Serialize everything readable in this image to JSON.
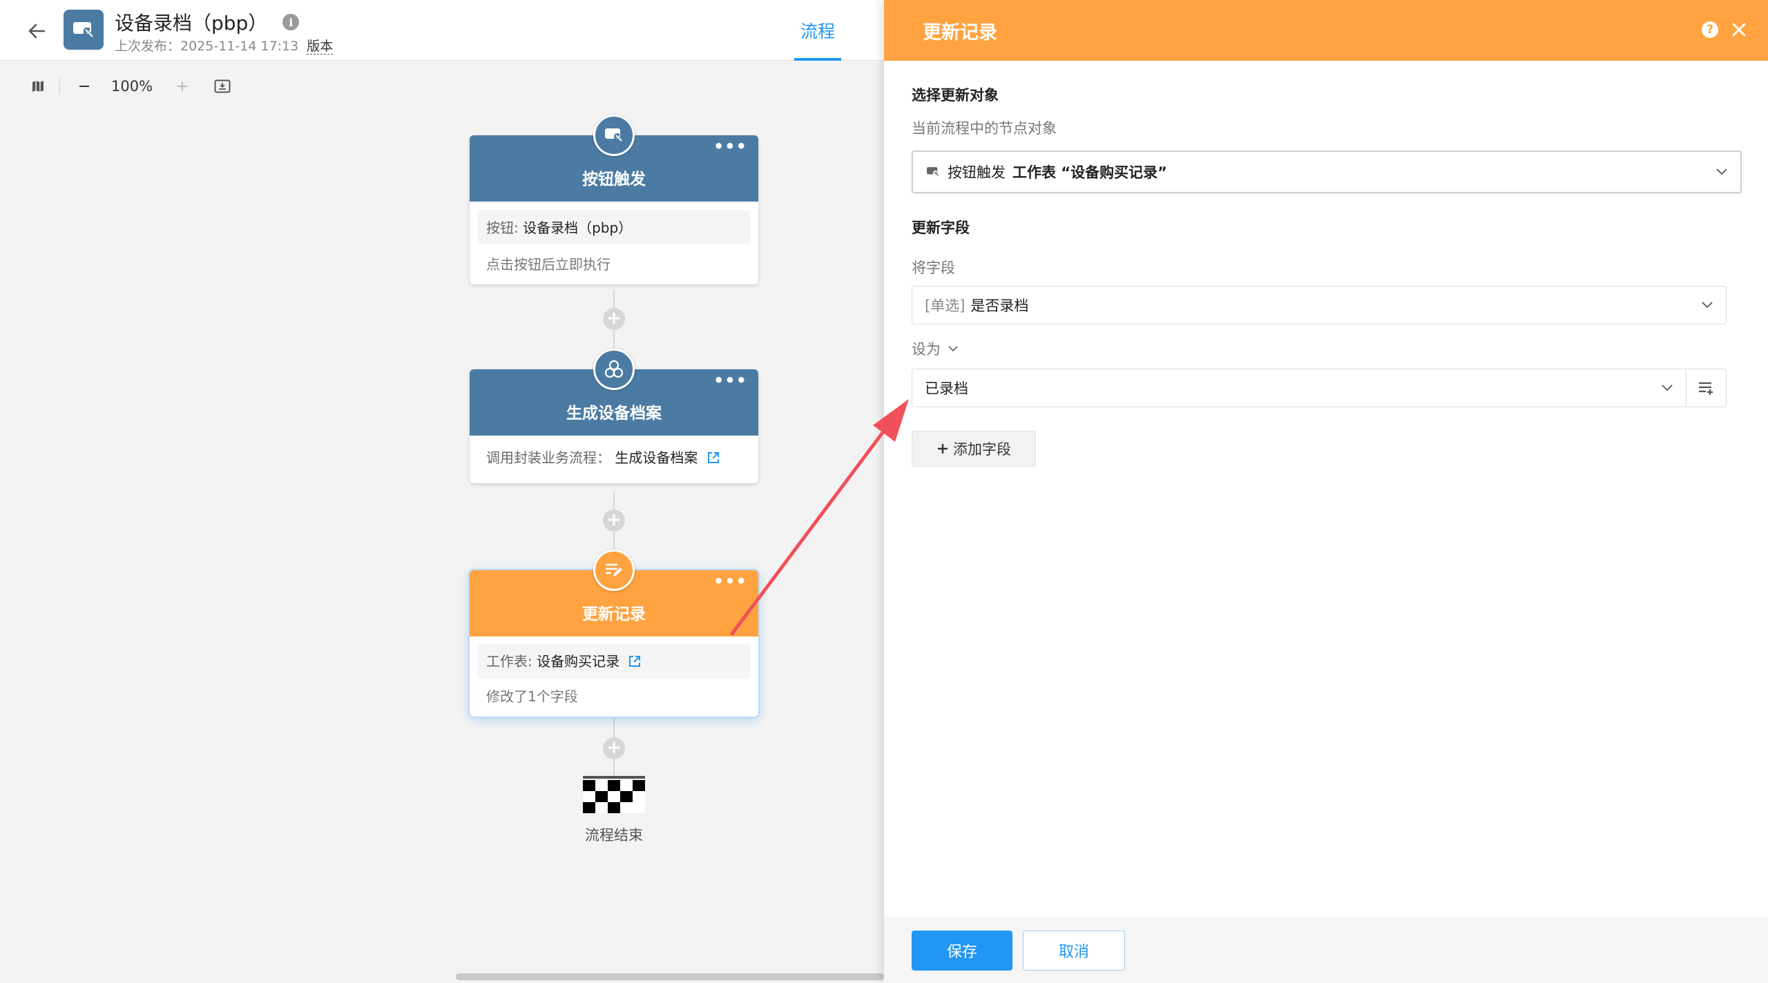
{
  "header": {
    "title": "设备录档（pbp）",
    "last_publish": "上次发布：2025-11-14 17:13",
    "version_label": "版本",
    "tab_flow": "流程"
  },
  "toolbar": {
    "zoom": "100%"
  },
  "flow": {
    "trigger": {
      "title": "按钮触发",
      "button_label": "按钮:",
      "button_value": "设备录档（pbp）",
      "desc": "点击按钮后立即执行"
    },
    "subprocess": {
      "title": "生成设备档案",
      "call_label": "调用封装业务流程：",
      "call_value": "生成设备档案"
    },
    "update": {
      "title": "更新记录",
      "sheet_label": "工作表:",
      "sheet_value": "设备购买记录",
      "desc": "修改了1个字段"
    },
    "end_label": "流程结束"
  },
  "panel": {
    "title": "更新记录",
    "help": "?",
    "target_section": "选择更新对象",
    "target_label": "当前流程中的节点对象",
    "target_node": "按钮触发",
    "target_value": "工作表 “设备购买记录”",
    "fields_section": "更新字段",
    "field_label": "将字段",
    "field_type_tag": "[单选]",
    "field_value": "是否录档",
    "set_label": "设为",
    "set_value": "已录档",
    "add_field": "添加字段",
    "save": "保存",
    "cancel": "取消"
  },
  "colors": {
    "node_blue": "#4b7ba3",
    "node_orange": "#ffa340",
    "primary": "#2196f3",
    "arrow": "#f0505a"
  }
}
